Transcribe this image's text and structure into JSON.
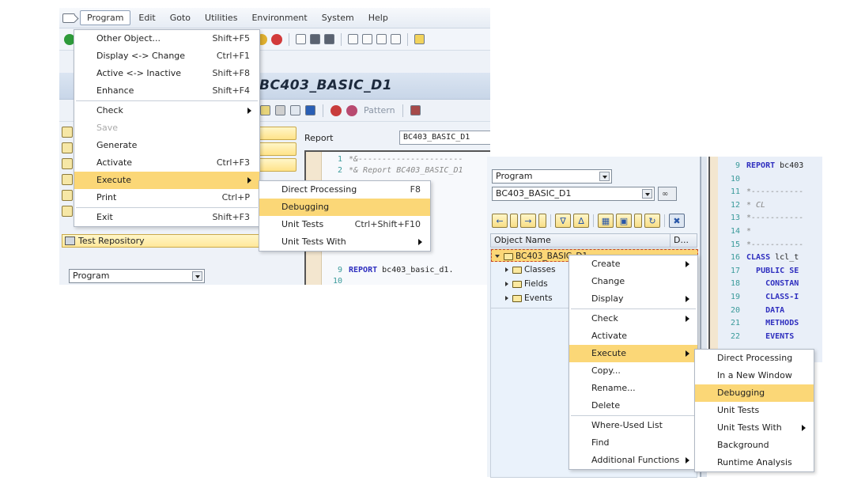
{
  "left": {
    "menubar": {
      "items": [
        {
          "label": "Program",
          "u": "P"
        },
        {
          "label": "Edit",
          "u": "E"
        },
        {
          "label": "Goto",
          "u": "G"
        },
        {
          "label": "Utilities",
          "u": "U"
        },
        {
          "label": "Environment",
          "u": "v"
        },
        {
          "label": "System",
          "u": "y"
        },
        {
          "label": "Help",
          "u": "H"
        }
      ]
    },
    "title": "t BC403_BASIC_D1",
    "toolbar2_pattern": "Pattern",
    "test_repository": "Test Repository",
    "object_type_combo": "Program",
    "editor": {
      "report_label": "Report",
      "report_name": "BC403_BASIC_D1",
      "lines": [
        {
          "n": "1",
          "code": "*&----------------------",
          "type": "cm"
        },
        {
          "n": "2",
          "code": "*& Report  BC403_BASIC_D1",
          "type": "cm"
        },
        {
          "n": "9",
          "kw": "REPORT",
          "code": "bc403_basic_d1.",
          "type": "kw"
        },
        {
          "n": "10",
          "code": "",
          "type": "tx"
        }
      ]
    },
    "program_menu": {
      "items": [
        {
          "label": "Other Object...",
          "shortcut": "Shift+F5",
          "state": "normal"
        },
        {
          "label": "Display <-> Change",
          "shortcut": "Ctrl+F1",
          "state": "normal"
        },
        {
          "label": "Active <-> Inactive",
          "shortcut": "Shift+F8",
          "state": "normal"
        },
        {
          "label": "Enhance",
          "shortcut": "Shift+F4",
          "state": "normal",
          "sep_after": true
        },
        {
          "label": "Check",
          "shortcut": "",
          "state": "submenu"
        },
        {
          "label": "Save",
          "shortcut": "",
          "state": "disabled"
        },
        {
          "label": "Generate",
          "shortcut": "",
          "state": "normal"
        },
        {
          "label": "Activate",
          "shortcut": "Ctrl+F3",
          "state": "normal"
        },
        {
          "label": "Execute",
          "shortcut": "",
          "state": "highlighted-submenu"
        },
        {
          "label": "Print",
          "shortcut": "Ctrl+P",
          "state": "normal",
          "sep_after": true
        },
        {
          "label": "Exit",
          "shortcut": "Shift+F3",
          "state": "normal"
        }
      ]
    },
    "execute_submenu": {
      "items": [
        {
          "label": "Direct Processing",
          "shortcut": "F8",
          "state": "normal"
        },
        {
          "label": "Debugging",
          "shortcut": "",
          "state": "highlighted"
        },
        {
          "label": "Unit Tests",
          "shortcut": "Ctrl+Shift+F10",
          "state": "normal"
        },
        {
          "label": "Unit Tests With",
          "shortcut": "",
          "state": "submenu"
        }
      ]
    }
  },
  "right": {
    "object_type_combo": "Program",
    "object_name_input": "BC403_BASIC_D1",
    "tree": {
      "header_name": "Object Name",
      "header_desc": "D...",
      "root": "BC403_BASIC_D1",
      "children": [
        "Classes",
        "Fields",
        "Events"
      ]
    },
    "editor": {
      "lines": [
        {
          "n": "9",
          "html": "<span class='kw'>REPORT</span> <span class='tx'>bc403</span>"
        },
        {
          "n": "10",
          "html": ""
        },
        {
          "n": "11",
          "html": "<span class='cm'>*-----------</span>"
        },
        {
          "n": "12",
          "html": "<span class='cm'>*        CL</span>"
        },
        {
          "n": "13",
          "html": "<span class='cm'>*-----------</span>"
        },
        {
          "n": "14",
          "html": "<span class='cm'>*</span>"
        },
        {
          "n": "15",
          "html": "<span class='cm'>*-----------</span>"
        },
        {
          "n": "16",
          "html": "<span class='kw'>CLASS</span> <span class='tx'>lcl_t</span>"
        },
        {
          "n": "17",
          "html": "&nbsp;&nbsp;<span class='kw'>PUBLIC SE</span>"
        },
        {
          "n": "18",
          "html": "&nbsp;&nbsp;&nbsp;&nbsp;<span class='kw'>CONSTAN</span>"
        },
        {
          "n": "19",
          "html": "&nbsp;&nbsp;&nbsp;&nbsp;<span class='kw'>CLASS-I</span>"
        },
        {
          "n": "20",
          "html": "&nbsp;&nbsp;&nbsp;&nbsp;<span class='kw'>DATA</span>"
        },
        {
          "n": "21",
          "html": "&nbsp;&nbsp;&nbsp;&nbsp;<span class='kw'>METHODS</span>"
        },
        {
          "n": "22",
          "html": "&nbsp;&nbsp;&nbsp;&nbsp;<span class='kw'>EVENTS</span>"
        }
      ]
    },
    "context_menu": {
      "items": [
        {
          "label": "Create",
          "state": "submenu"
        },
        {
          "label": "Change",
          "state": "normal"
        },
        {
          "label": "Display",
          "state": "submenu",
          "sep_after": true
        },
        {
          "label": "Check",
          "state": "submenu"
        },
        {
          "label": "Activate",
          "state": "normal"
        },
        {
          "label": "Execute",
          "state": "highlighted-submenu"
        },
        {
          "label": "Copy...",
          "state": "normal"
        },
        {
          "label": "Rename...",
          "state": "normal"
        },
        {
          "label": "Delete",
          "state": "normal",
          "sep_after": true
        },
        {
          "label": "Where-Used List",
          "state": "normal"
        },
        {
          "label": "Find",
          "state": "normal"
        },
        {
          "label": "Additional Functions",
          "state": "submenu"
        }
      ]
    },
    "execute_submenu": {
      "items": [
        {
          "label": "Direct Processing",
          "state": "normal"
        },
        {
          "label": "In a New Window",
          "state": "normal"
        },
        {
          "label": "Debugging",
          "state": "highlighted"
        },
        {
          "label": "Unit Tests",
          "state": "normal"
        },
        {
          "label": "Unit Tests With",
          "state": "submenu"
        },
        {
          "label": "Background",
          "state": "normal"
        },
        {
          "label": "Runtime Analysis",
          "state": "normal"
        }
      ]
    }
  },
  "colors": {
    "highlight": "#fbd777",
    "keyword": "#2f2fbf",
    "line_number": "#3a9a9a"
  }
}
